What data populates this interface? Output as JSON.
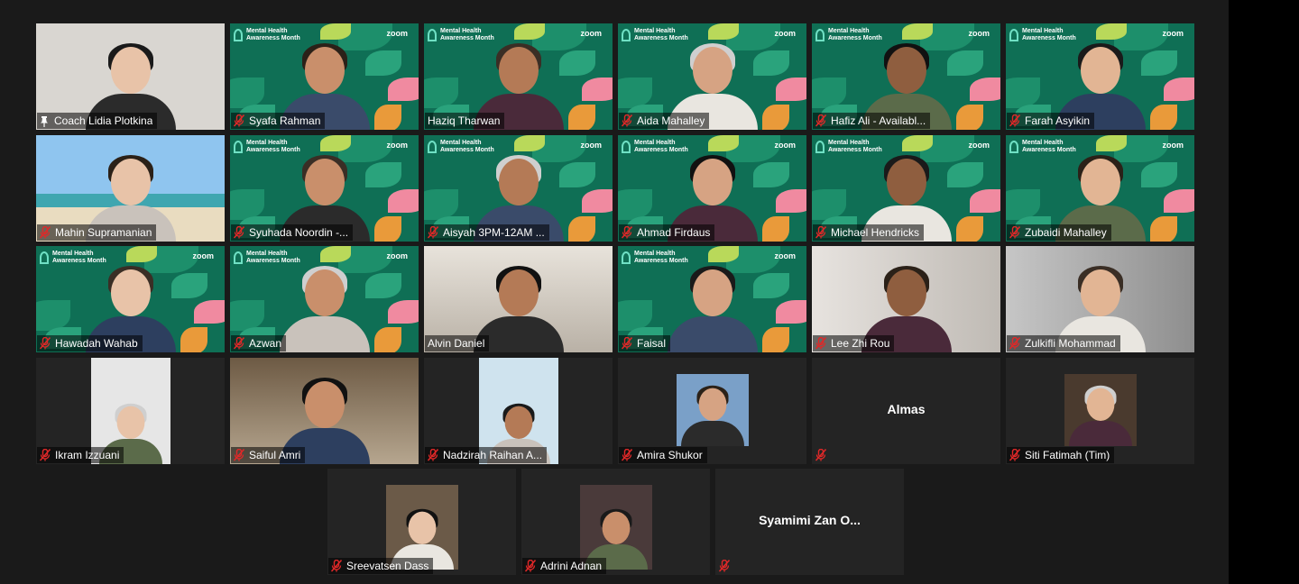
{
  "participants": [
    {
      "name": "Coach Lidia Plotkina",
      "pinned": true,
      "muted": false,
      "background": "plain",
      "active": false
    },
    {
      "name": "Syafa Rahman",
      "muted": true,
      "background": "Mental Health Awareness Month",
      "active": false
    },
    {
      "name": "Haziq Tharwan",
      "muted": false,
      "background": "Mental Health Awareness Month",
      "active": true
    },
    {
      "name": "Aida Mahalley",
      "muted": true,
      "background": "Mental Health Awareness Month",
      "active": false
    },
    {
      "name": "Hafiz Ali - Availabl...",
      "muted": true,
      "background": "Mental Health Awareness Month",
      "active": false
    },
    {
      "name": "Farah Asyikin",
      "muted": true,
      "background": "Mental Health Awareness Month",
      "active": false
    },
    {
      "name": "Mahin Supramanian",
      "muted": true,
      "background": "beach",
      "active": false
    },
    {
      "name": "Syuhada Noordin -...",
      "muted": true,
      "background": "Mental Health Awareness Month",
      "active": false
    },
    {
      "name": "Aisyah 3PM-12AM ...",
      "muted": true,
      "background": "Mental Health Awareness Month",
      "active": false
    },
    {
      "name": "Ahmad Firdaus",
      "muted": true,
      "background": "Mental Health Awareness Month",
      "active": false
    },
    {
      "name": "Michael Hendricks",
      "muted": true,
      "background": "Mental Health Awareness Month",
      "active": false
    },
    {
      "name": "Zubaidi Mahalley",
      "muted": true,
      "background": "Mental Health Awareness Month",
      "active": false
    },
    {
      "name": "Hawadah Wahab",
      "muted": true,
      "background": "Mental Health Awareness Month",
      "active": false
    },
    {
      "name": "Azwan",
      "muted": true,
      "background": "Mental Health Awareness Month",
      "active": false
    },
    {
      "name": "Alvin Daniel",
      "muted": false,
      "background": "room",
      "active": false
    },
    {
      "name": "Faisal",
      "muted": true,
      "background": "Mental Health Awareness Month",
      "active": false
    },
    {
      "name": "Lee Zhi Rou",
      "muted": true,
      "background": "blur",
      "active": false
    },
    {
      "name": "Zulkifli Mohammad",
      "muted": true,
      "background": "grey",
      "active": false
    },
    {
      "name": "Ikram Izzuani",
      "muted": true,
      "background": "portrait",
      "active": false
    },
    {
      "name": "Saiful Amri",
      "muted": true,
      "background": "office",
      "active": false
    },
    {
      "name": "Nadzirah Raihan A...",
      "muted": true,
      "background": "portrait",
      "active": false
    },
    {
      "name": "Amira Shukor",
      "muted": true,
      "background": "portrait",
      "active": false
    },
    {
      "name": "",
      "display_name": "Almas",
      "muted": true,
      "video_off": true,
      "active": false
    },
    {
      "name": "Siti Fatimah (Tim)",
      "muted": true,
      "background": "portrait",
      "active": false
    },
    {
      "name": "Sreevatsen Dass",
      "muted": true,
      "background": "portrait",
      "active": false
    },
    {
      "name": "Adrini Adnan",
      "muted": true,
      "background": "portrait",
      "active": false
    },
    {
      "name": "",
      "display_name": "Syamimi Zan O...",
      "muted": true,
      "video_off": true,
      "active": false
    }
  ],
  "virtual_background": {
    "line1": "Mental Health",
    "line2": "Awareness Month",
    "logo": "zoom"
  },
  "colors": {
    "active_border": "#e6e35b",
    "muted_icon": "#e02828",
    "tile_bg": "#242424",
    "gallery_bg": "#1a1a1a",
    "green_bg": "#0f6f55"
  }
}
